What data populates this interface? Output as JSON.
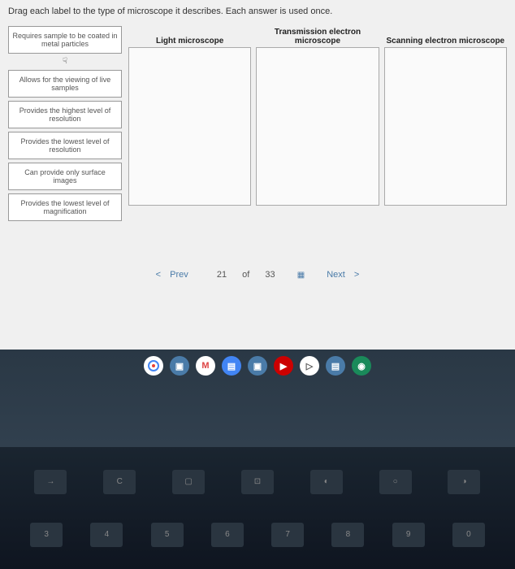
{
  "instructions": "Drag each label to the type of microscope it describes. Each answer is used once.",
  "labels": [
    "Requires sample to be coated in metal particles",
    "Allows for the viewing of live samples",
    "Provides the highest level of resolution",
    "Provides the lowest level of resolution",
    "Can provide only surface images",
    "Provides the lowest level of magnification"
  ],
  "dropzones": [
    {
      "title": "Light microscope"
    },
    {
      "title": "Transmission electron microscope"
    },
    {
      "title": "Scanning electron microscope"
    }
  ],
  "pager": {
    "prev": "Prev",
    "current": "21",
    "of": "of",
    "total": "33",
    "next": "Next"
  },
  "keyboard": {
    "row1": [
      "→",
      "C",
      "▢",
      "⊡",
      "◐",
      "○",
      "◑"
    ],
    "row2": [
      "3",
      "4",
      "5",
      "6",
      "7",
      "8",
      "9",
      "0"
    ],
    "row2_upper": [
      "#",
      "$",
      "%",
      "^",
      "&",
      "*",
      "(",
      ")"
    ]
  }
}
